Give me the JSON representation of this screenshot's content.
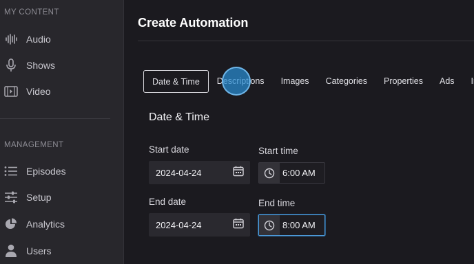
{
  "sidebar": {
    "section_my_content": "MY CONTENT",
    "content_items": [
      {
        "label": "Audio",
        "icon": "waveform-icon"
      },
      {
        "label": "Shows",
        "icon": "microphone-icon"
      },
      {
        "label": "Video",
        "icon": "video-icon"
      }
    ],
    "section_management": "MANAGEMENT",
    "management_items": [
      {
        "label": "Episodes",
        "icon": "list-icon"
      },
      {
        "label": "Setup",
        "icon": "sliders-icon"
      },
      {
        "label": "Analytics",
        "icon": "pie-chart-icon"
      },
      {
        "label": "Users",
        "icon": "user-icon"
      }
    ]
  },
  "header": {
    "title": "Create Automation"
  },
  "tabs": [
    {
      "label": "Date & Time",
      "active": true
    },
    {
      "label": "Descriptions"
    },
    {
      "label": "Images"
    },
    {
      "label": "Categories"
    },
    {
      "label": "Properties"
    },
    {
      "label": "Ads"
    },
    {
      "label": "Int"
    }
  ],
  "form": {
    "section_title": "Date & Time",
    "start_date_label": "Start date",
    "start_date_value": "2024-04-24",
    "start_time_label": "Start time",
    "start_time_value": "6:00 AM",
    "end_date_label": "End date",
    "end_date_value": "2024-04-24",
    "end_time_label": "End time",
    "end_time_value": "8:00 AM"
  },
  "colors": {
    "background": "#1b1a1f",
    "sidebar": "#28272c",
    "focus_accent": "#4e9ad8",
    "click_indicator": "#288cd2"
  }
}
